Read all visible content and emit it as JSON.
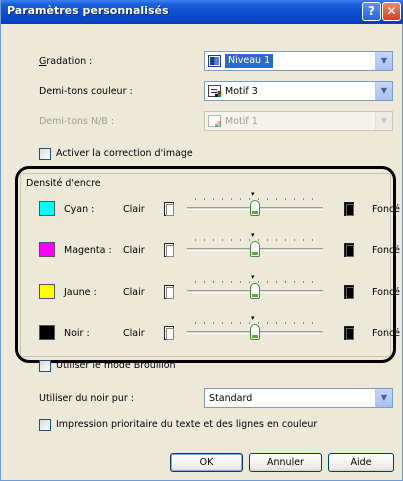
{
  "window": {
    "title": "Paramètres personnalisés",
    "help": "?",
    "close": "✕"
  },
  "gradation": {
    "label": "Gradation :",
    "value": "Niveau 1"
  },
  "demi_tons_couleur": {
    "label": "Demi-tons couleur :",
    "value": "Motif 3"
  },
  "demi_tons_nb": {
    "label": "Demi-tons N/B :",
    "value": "Motif 1"
  },
  "correction": {
    "label": "Activer la correction d'image"
  },
  "densite": {
    "title": "Densité d'encre",
    "light_label": "Clair",
    "dark_label": "Foncé",
    "inks": [
      {
        "name": "Cyan :",
        "color": "#00ffff",
        "value": 0.5
      },
      {
        "name": "Magenta :",
        "color": "#ff00ff",
        "value": 0.5
      },
      {
        "name": "Jaune :",
        "color": "#ffff00",
        "value": 0.5
      },
      {
        "name": "Noir :",
        "color": "#000000",
        "value": 0.5
      }
    ]
  },
  "brouillon": {
    "label": "Utiliser le mode Brouillon"
  },
  "noir_pur": {
    "label": "Utiliser du noir pur :",
    "value": "Standard"
  },
  "impression_prioritaire": {
    "label": "Impression prioritaire du texte et des lignes en couleur"
  },
  "buttons": {
    "ok": "OK",
    "cancel": "Annuler",
    "help": "Aide"
  },
  "icons": {
    "dropdown": "chevron-down-icon",
    "slider_mark": "▾"
  }
}
